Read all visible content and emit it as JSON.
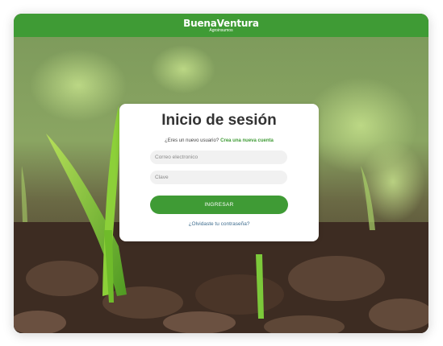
{
  "header": {
    "logo_text": "BuenaVentura",
    "logo_sub": "Agroinsumos"
  },
  "login": {
    "title": "Inicio de sesión",
    "new_user_prompt": "¿Eres un nuevo usuario?",
    "create_account_link": "Crea una nueva cuenta",
    "email_placeholder": "Correo electronico",
    "password_placeholder": "Clave",
    "submit_label": "INGRESAR",
    "forgot_link": "¿Olvidaste tu contraseña?"
  },
  "colors": {
    "brand_green": "#3f9b35",
    "soil": "#3a2a1f",
    "sprout": "#6dbf3a"
  },
  "background": {
    "description_icon": "sprout-in-soil-photo"
  }
}
